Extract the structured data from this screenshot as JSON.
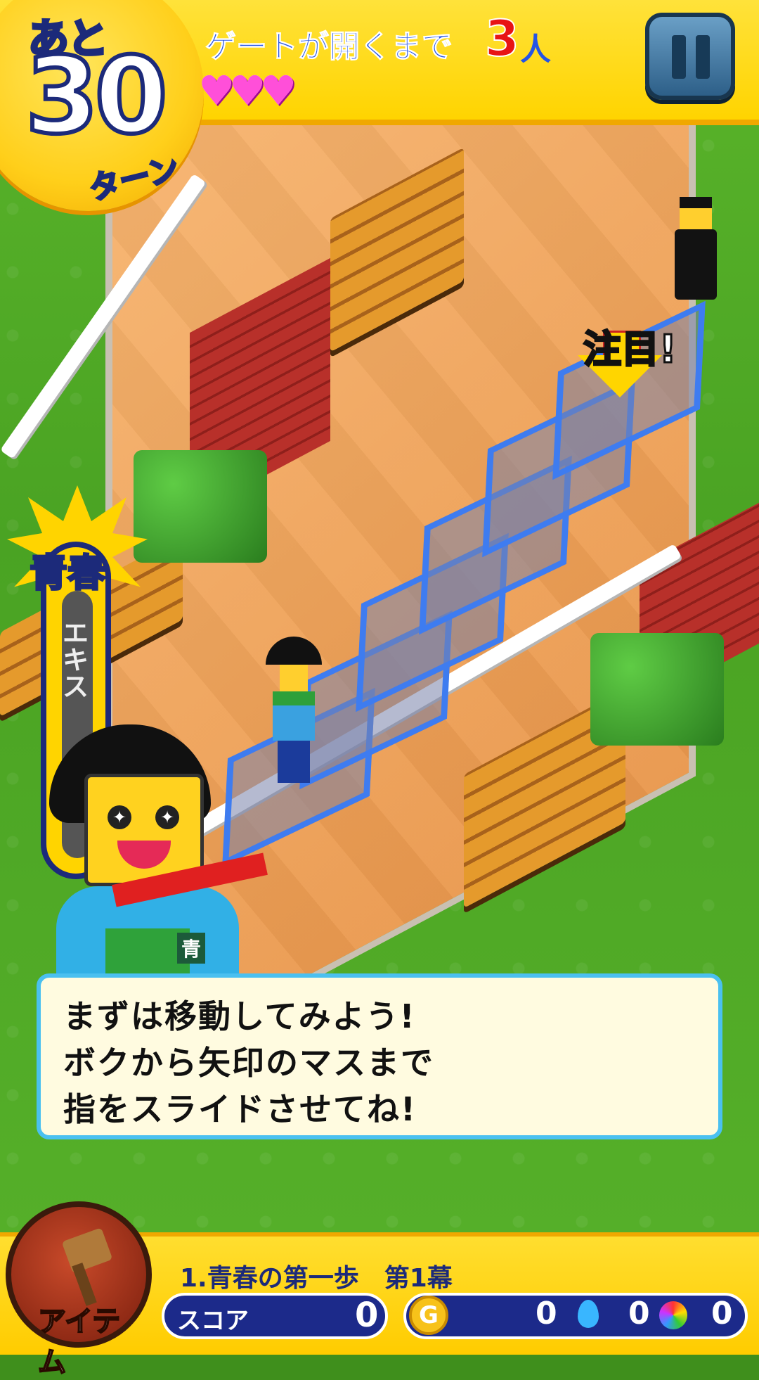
{
  "hud": {
    "turns_prefix": "あと",
    "turns_remaining": "30",
    "turns_unit": "ターン",
    "gate_label": "ゲートが開くまで",
    "gate_count": "3",
    "gate_unit": "人",
    "hearts": "♥♥♥",
    "hearts_count": 3
  },
  "board": {
    "focus_label": "注目!"
  },
  "meter": {
    "title": "青春",
    "text": "エキス"
  },
  "mascot": {
    "tag": "青"
  },
  "dialog": {
    "lines": [
      "まずは移動してみよう!",
      "ボクから矢印のマスまで",
      "指をスライドさせてね!"
    ]
  },
  "bottom": {
    "item_label": "アイテム",
    "stage_name": "1.青春の第一歩　第1幕",
    "score_label": "スコア",
    "score_value": "0",
    "coins": "0",
    "drops": "0",
    "rainbow": "0"
  },
  "colors": {
    "hud_yellow": "#ffd400",
    "text_blue": "#2454e6",
    "count_red": "#e81414",
    "heart_pink": "#ff4fd9",
    "path_blue": "#3e7cf0"
  }
}
